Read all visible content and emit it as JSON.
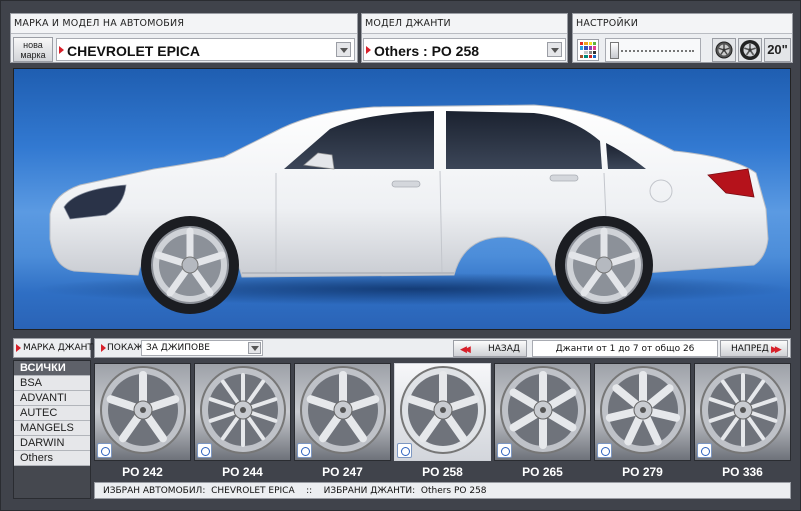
{
  "car_panel": {
    "title": "МАРКА И МОДЕЛ НА АВТОМОБИЯ",
    "new_brand_label_line1": "нова",
    "new_brand_label_line2": "марка",
    "selected_model": "CHEVROLET EPICA"
  },
  "rim_panel": {
    "title": "МОДЕЛ ДЖАНТИ",
    "selected_rim": "Others : PO 258"
  },
  "settings_panel": {
    "title": "НАСТРОЙКИ",
    "rim_size": "20\"",
    "color_swatches": [
      "#e2271f",
      "#f2a21d",
      "#f6e21f",
      "#5fb33e",
      "#2f9fdc",
      "#3650b8",
      "#8a3fb0",
      "#e23f8f",
      "#ffffff",
      "#c8c8c8",
      "#888888",
      "#333333",
      "#a0522d",
      "#00897b",
      "#c62828",
      "#1565c0"
    ],
    "slider_fraction": 0.0
  },
  "preview": {
    "car_color": "#f4f5f7",
    "background_top": "#1f5eb1",
    "background_bottom": "#2a63b6"
  },
  "filter_bar": {
    "brand_label": "МАРКА ДЖАНТИ",
    "show_label": "ПОКАЖИ",
    "show_value": "ЗА ДЖИПОВЕ",
    "back_label": "НАЗАД",
    "range_text": "Джанти от 1 до 7 от общо 26",
    "next_label": "НАПРЕД"
  },
  "brands": [
    "ВСИЧКИ",
    "BSA",
    "ADVANTI",
    "AUTEC",
    "MANGELS",
    "DARWIN",
    "Others"
  ],
  "active_brand": "ВСИЧКИ",
  "rims": [
    {
      "label": "PO 242",
      "spokes": 5,
      "selected": false
    },
    {
      "label": "PO 244",
      "spokes": 10,
      "selected": false
    },
    {
      "label": "PO 247",
      "spokes": 5,
      "selected": false
    },
    {
      "label": "PO 258",
      "spokes": 5,
      "selected": true
    },
    {
      "label": "PO 265",
      "spokes": 6,
      "selected": false
    },
    {
      "label": "PO 279",
      "spokes": 7,
      "selected": false
    },
    {
      "label": "PO 336",
      "spokes": 10,
      "selected": false
    }
  ],
  "status": {
    "car_label": "ИЗБРАН АВТОМОБИЛ:",
    "car_value": "CHEVROLET EPICA",
    "separator": "::",
    "rim_label": "ИЗБРАНИ ДЖАНТИ:",
    "rim_value": "Others PO 258"
  }
}
